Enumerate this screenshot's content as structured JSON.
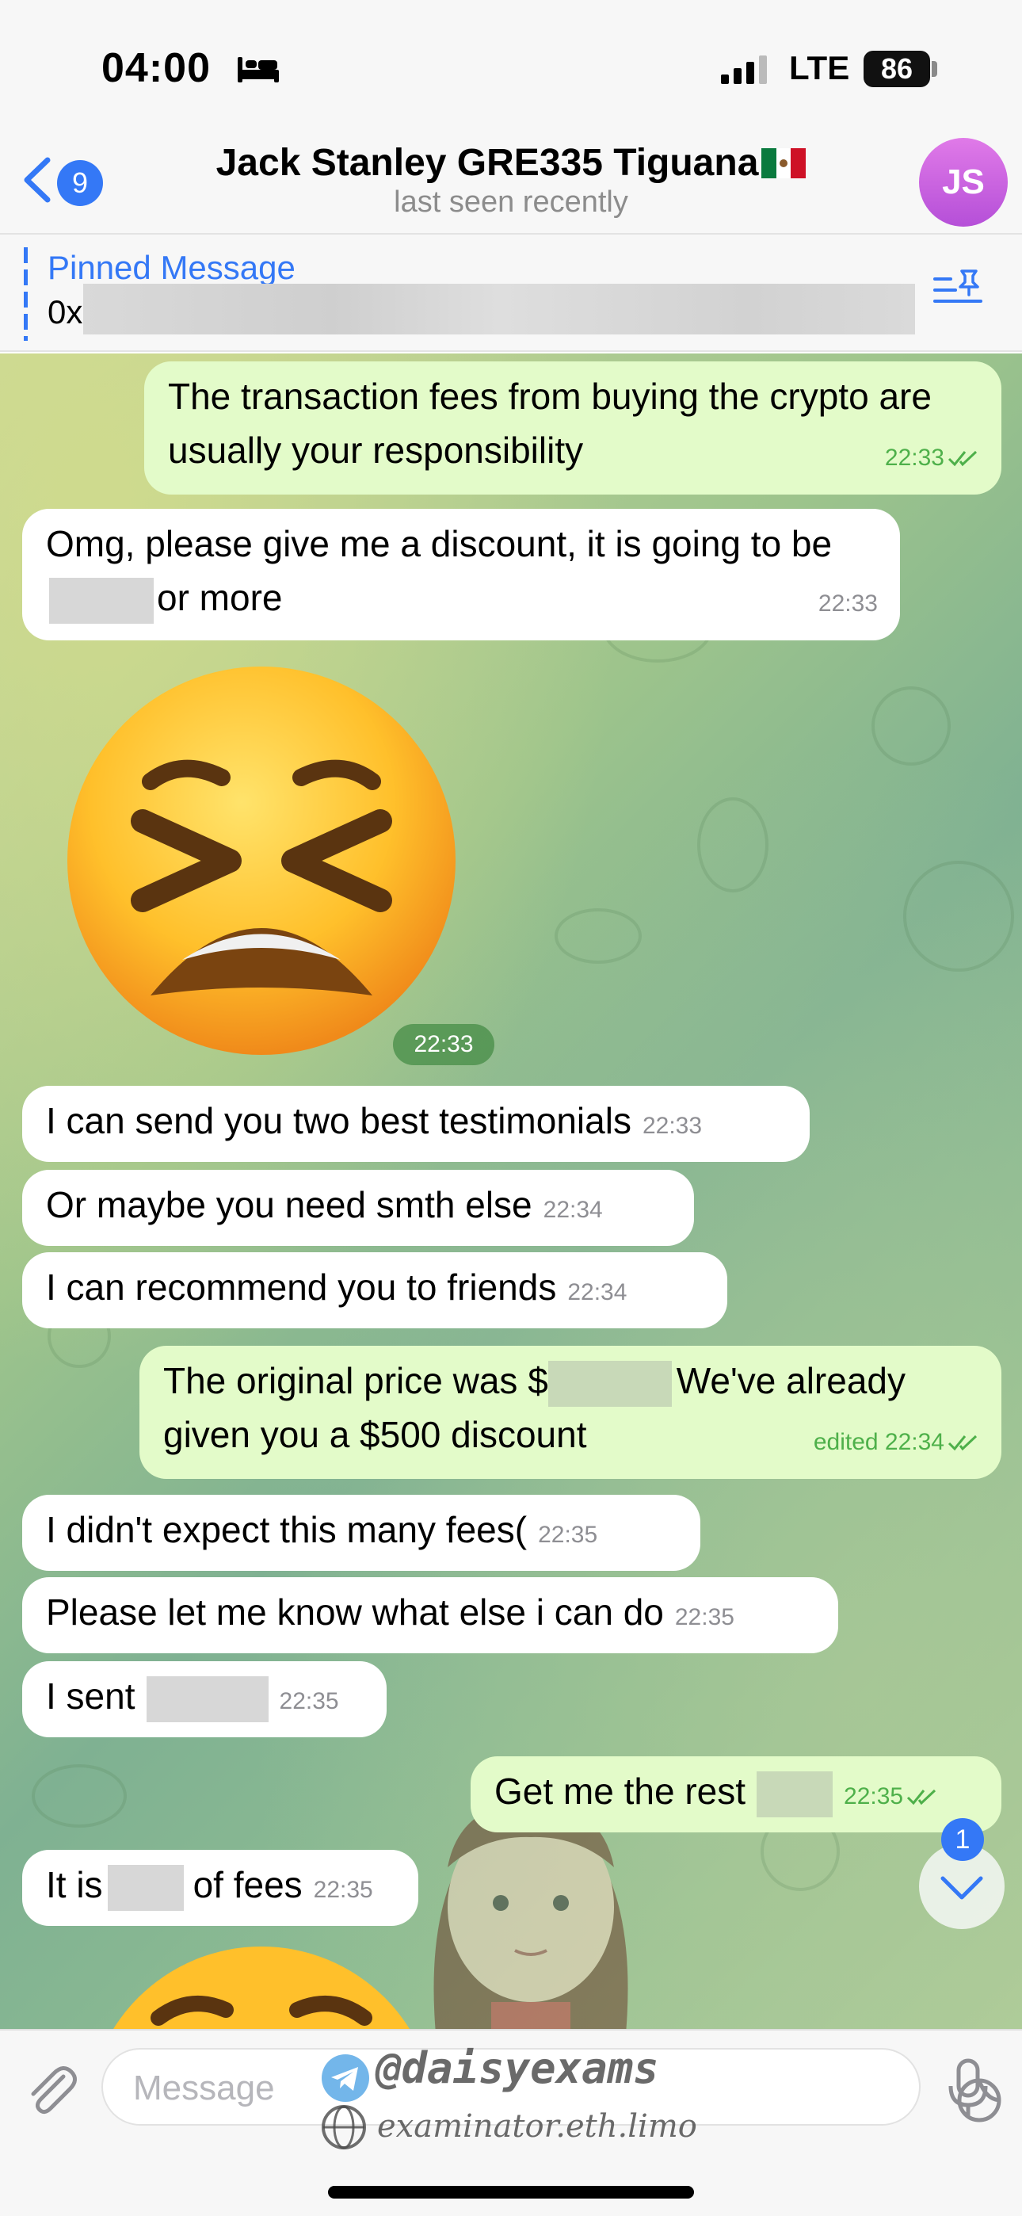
{
  "status": {
    "time": "04:00",
    "network": "LTE",
    "battery": "86"
  },
  "header": {
    "back_badge": "9",
    "title": "Jack Stanley GRE335 Tiguana",
    "subtitle": "last seen recently",
    "avatar_initials": "JS"
  },
  "pinned": {
    "label": "Pinned Message",
    "text": "0x"
  },
  "messages": [
    {
      "dir": "out",
      "text": "The transaction fees from buying the crypto are usually your responsibility",
      "time": "22:33"
    },
    {
      "dir": "in",
      "text_a": "Omg, please give me a discount, it is going to be",
      "text_b": "or more",
      "time": "22:33"
    },
    {
      "dir": "in",
      "type": "sticker",
      "time": "22:33"
    },
    {
      "dir": "in",
      "text": "I can send you two best testimonials",
      "time": "22:33"
    },
    {
      "dir": "in",
      "text": "Or maybe you need smth else",
      "time": "22:34"
    },
    {
      "dir": "in",
      "text": "I can recommend you to friends",
      "time": "22:34"
    },
    {
      "dir": "out",
      "text_a": "The original price was $",
      "text_b": "We've already given you a $500 discount",
      "status": "edited",
      "time": "22:34"
    },
    {
      "dir": "in",
      "text": "I didn't expect this many fees(",
      "time": "22:35"
    },
    {
      "dir": "in",
      "text": "Please let me know what else i can do",
      "time": "22:35"
    },
    {
      "dir": "in",
      "text": "I sent",
      "time": "22:35"
    },
    {
      "dir": "out",
      "text": "Get me the rest",
      "time": "22:35"
    },
    {
      "dir": "in",
      "text_a": "It is",
      "text_b": "of fees",
      "time": "22:35"
    }
  ],
  "scroll_badge": "1",
  "composer": {
    "placeholder": "Message"
  },
  "watermark": {
    "handle": "@daisyexams",
    "url": "examinator.eth.limo"
  },
  "colors": {
    "accent": "#3478f6",
    "outgoing": "#e3fbc9",
    "incoming": "#ffffff",
    "avatar": "#c865e0"
  }
}
